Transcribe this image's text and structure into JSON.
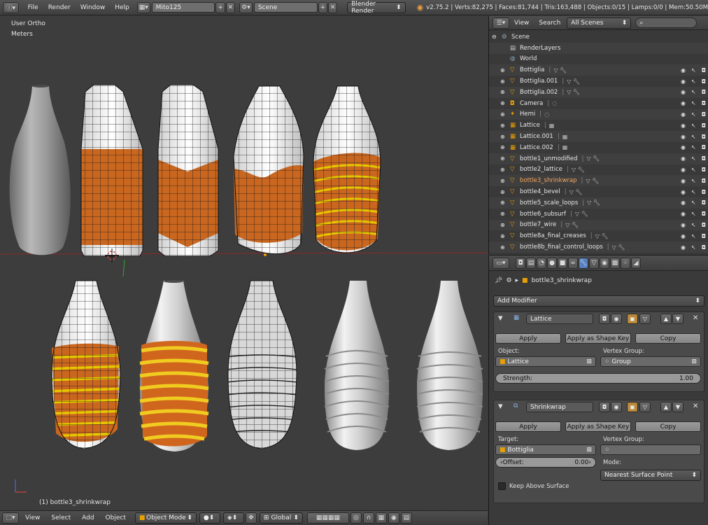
{
  "topbar": {
    "menus": [
      "File",
      "Render",
      "Window",
      "Help"
    ],
    "screen_layout": "Mito125",
    "scene": "Scene",
    "render_engine": "Blender Render",
    "stats": "v2.75.2 | Verts:82,275 | Faces:81,744 | Tris:163,488 | Objects:0/15 | Lamps:0/0 | Mem:50.50M"
  },
  "viewport": {
    "view_name": "User Ortho",
    "units": "Meters",
    "active_object_label": "(1) bottle3_shrinkwrap",
    "footer": {
      "menus": [
        "View",
        "Select",
        "Add",
        "Object"
      ],
      "mode": "Object Mode",
      "orientation": "Global"
    }
  },
  "outliner": {
    "menus": [
      "View",
      "Search"
    ],
    "filter": "All Scenes",
    "search_placeholder": "",
    "items": [
      {
        "label": "Scene",
        "icon": "scene-icon",
        "indent": 0
      },
      {
        "label": "RenderLayers",
        "icon": "render-layers-icon",
        "indent": 1
      },
      {
        "label": "World",
        "icon": "world-icon",
        "indent": 1
      },
      {
        "label": "Bottiglia",
        "icon": "mesh-icon",
        "indent": 1
      },
      {
        "label": "Bottiglia.001",
        "icon": "mesh-icon",
        "indent": 1
      },
      {
        "label": "Bottiglia.002",
        "icon": "mesh-icon",
        "indent": 1
      },
      {
        "label": "Camera",
        "icon": "camera-icon",
        "indent": 1
      },
      {
        "label": "Hemi",
        "icon": "lamp-icon",
        "indent": 1
      },
      {
        "label": "Lattice",
        "icon": "lattice-icon",
        "indent": 1
      },
      {
        "label": "Lattice.001",
        "icon": "lattice-icon",
        "indent": 1
      },
      {
        "label": "Lattice.002",
        "icon": "lattice-icon",
        "indent": 1
      },
      {
        "label": "bottle1_unmodified",
        "icon": "mesh-icon",
        "indent": 1
      },
      {
        "label": "bottle2_lattice",
        "icon": "mesh-icon",
        "indent": 1
      },
      {
        "label": "bottle3_shrinkwrap",
        "icon": "mesh-icon",
        "indent": 1
      },
      {
        "label": "bottle4_bevel",
        "icon": "mesh-icon",
        "indent": 1
      },
      {
        "label": "bottle5_scale_loops",
        "icon": "mesh-icon",
        "indent": 1
      },
      {
        "label": "bottle6_subsurf",
        "icon": "mesh-icon",
        "indent": 1
      },
      {
        "label": "bottle7_wire",
        "icon": "mesh-icon",
        "indent": 1
      },
      {
        "label": "bottle8a_final_creases",
        "icon": "mesh-icon",
        "indent": 1
      },
      {
        "label": "bottle8b_final_control_loops",
        "icon": "mesh-icon",
        "indent": 1
      }
    ]
  },
  "properties": {
    "breadcrumb_object": "bottle3_shrinkwrap",
    "add_modifier": "Add Modifier",
    "modifiers": [
      {
        "name": "Lattice",
        "apply": "Apply",
        "apply_shape": "Apply as Shape Key",
        "copy": "Copy",
        "object_label": "Object:",
        "object_value": "Lattice",
        "vgroup_label": "Vertex Group:",
        "vgroup_value": "Group",
        "strength_label": "Strength:",
        "strength_value": "1.00"
      },
      {
        "name": "Shrinkwrap",
        "apply": "Apply",
        "apply_shape": "Apply as Shape Key",
        "copy": "Copy",
        "target_label": "Target:",
        "target_value": "Bottiglia",
        "vgroup_label": "Vertex Group:",
        "vgroup_value": "",
        "offset_label": "Offset:",
        "offset_value": "0.00",
        "mode_label": "Mode:",
        "mode_value": "Nearest Surface Point",
        "keep_above_label": "Keep Above Surface",
        "keep_above": false
      }
    ]
  },
  "colors": {
    "accent_orange": "#d0661e",
    "ring_yellow": "#e6c800",
    "selected_text": "#f4a860"
  }
}
